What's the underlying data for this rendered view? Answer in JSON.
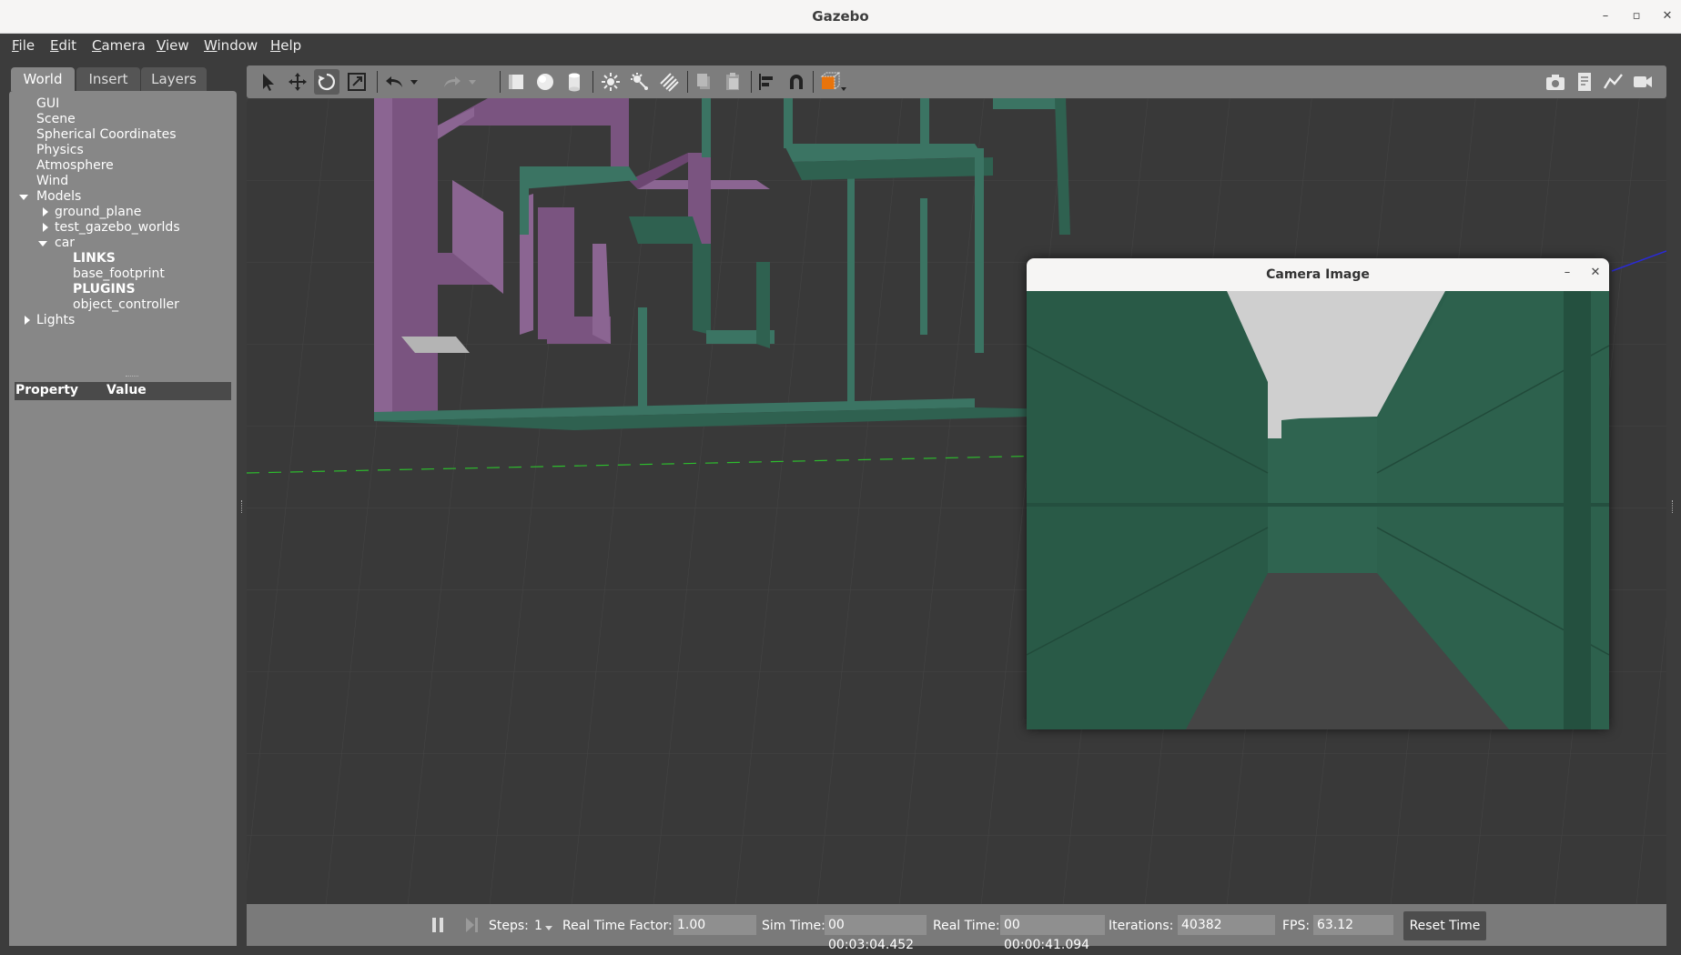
{
  "window": {
    "title": "Gazebo",
    "controls": [
      "minimize-icon",
      "restore-icon",
      "close-icon"
    ]
  },
  "menubar": {
    "items": [
      {
        "label": "File",
        "key": "F"
      },
      {
        "label": "Edit",
        "key": "E"
      },
      {
        "label": "Camera",
        "key": "C"
      },
      {
        "label": "View",
        "key": "V"
      },
      {
        "label": "Window",
        "key": "W"
      },
      {
        "label": "Help",
        "key": "H"
      }
    ]
  },
  "tabs": [
    {
      "label": "World",
      "active": true
    },
    {
      "label": "Insert",
      "active": false
    },
    {
      "label": "Layers",
      "active": false
    }
  ],
  "world_tree": {
    "gui": "GUI",
    "scene": "Scene",
    "spherical": "Spherical Coordinates",
    "physics": "Physics",
    "atmosphere": "Atmosphere",
    "wind": "Wind",
    "models": "Models",
    "ground_plane": "ground_plane",
    "test_worlds": "test_gazebo_worlds",
    "car": "car",
    "links": "LINKS",
    "base_footprint": "base_footprint",
    "plugins": "PLUGINS",
    "object_controller": "object_controller",
    "lights": "Lights"
  },
  "property_table": {
    "col_property": "Property",
    "col_value": "Value"
  },
  "toolbar": {
    "icons": [
      "select-arrow-icon",
      "translate-icon",
      "rotate-icon",
      "scale-icon",
      "undo-icon",
      "undo-dropdown-icon",
      "redo-icon",
      "redo-dropdown-icon",
      "box-icon",
      "sphere-icon",
      "cylinder-icon",
      "point-light-icon",
      "spot-light-icon",
      "directional-light-icon",
      "copy-icon",
      "paste-icon",
      "align-icon",
      "snap-icon",
      "view-angle-icon",
      "screenshot-icon",
      "log-icon",
      "plot-icon",
      "record-video-icon"
    ]
  },
  "camera_window": {
    "title": "Camera Image"
  },
  "bottombar": {
    "steps_label": "Steps:",
    "steps_value": "1",
    "rtf_label": "Real Time Factor:",
    "rtf_value": "1.00",
    "sim_label": "Sim Time:",
    "sim_value": "00 00:03:04.452",
    "real_label": "Real Time:",
    "real_value": "00 00:00:41.094",
    "iter_label": "Iterations:",
    "iter_value": "40382",
    "fps_label": "FPS:",
    "fps_value": "63.12",
    "reset_label": "Reset Time"
  },
  "colors": {
    "maze_green": "#2f6150",
    "maze_purple": "#7a5480",
    "panel": "#878787",
    "viewport": "#393939"
  }
}
